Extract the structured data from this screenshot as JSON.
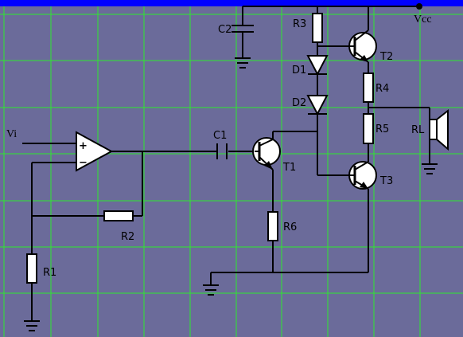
{
  "labels": {
    "vcc": "Vcc",
    "vi": "Vi",
    "c1": "C1",
    "c2": "C2",
    "r1": "R1",
    "r2": "R2",
    "r3": "R3",
    "r4": "R4",
    "r5": "R5",
    "r6": "R6",
    "d1": "D1",
    "d2": "D2",
    "t1": "T1",
    "t2": "T2",
    "t3": "T3",
    "rl": "RL",
    "plus": "+",
    "minus": "−"
  },
  "colors": {
    "background": "#6b6b9a",
    "grid": "#2ee82e",
    "top_bar": "#0000ff",
    "wire": "#000000",
    "component_fill": "#ffffff"
  }
}
